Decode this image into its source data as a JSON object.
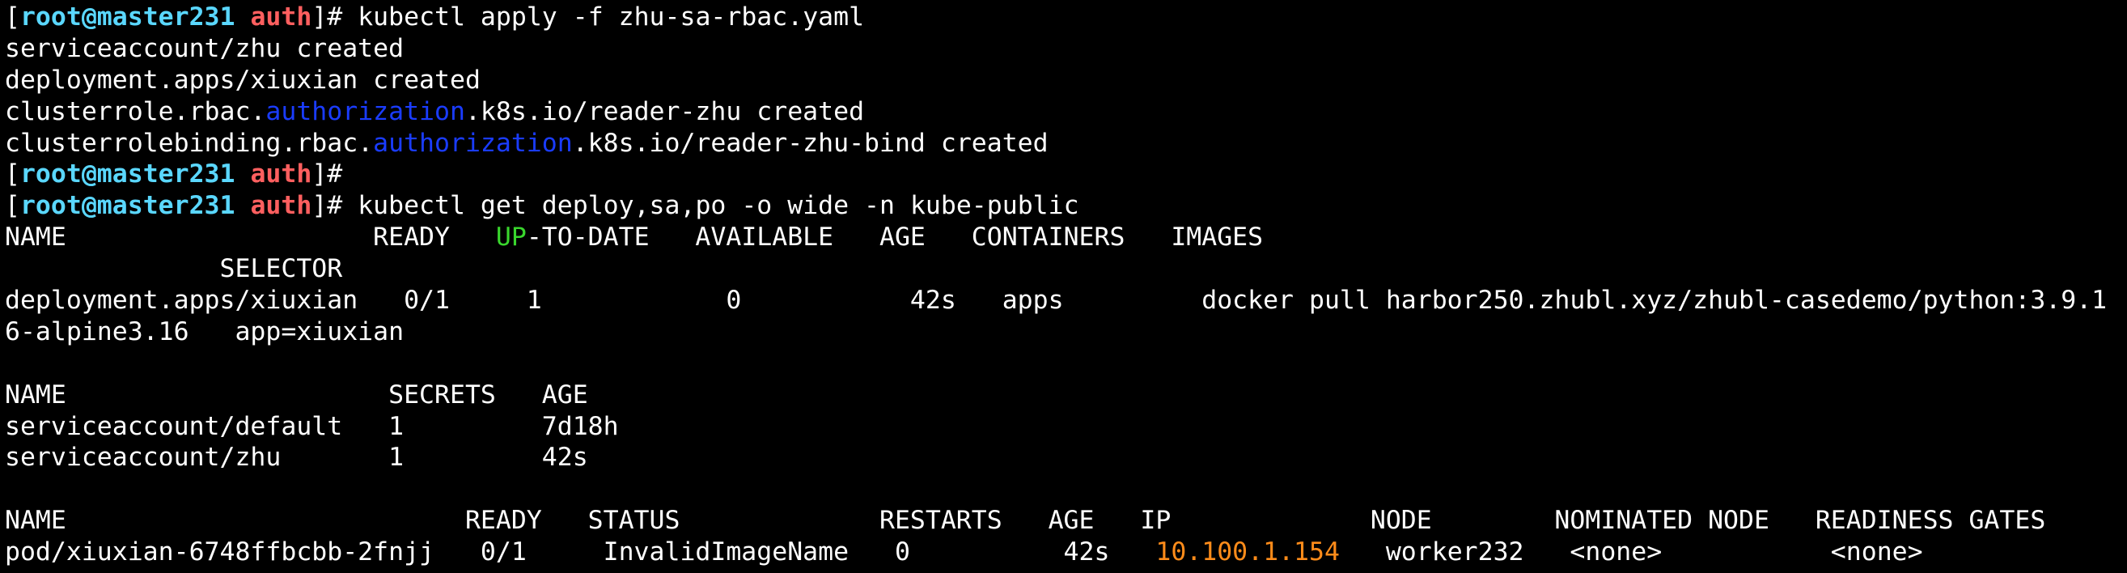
{
  "prompt": {
    "user": "root",
    "host": "master231",
    "dir": "auth",
    "symbol": "#"
  },
  "colors": {
    "background": "#000000",
    "text": "#ffffff",
    "prompt_user_host": "#5ad7ff",
    "prompt_dir": "#ff5f5f",
    "highlight_green": "#39d62d",
    "highlight_blue": "#1a3cff",
    "highlight_orange": "#ff8c1a"
  },
  "commands": {
    "apply": "kubectl apply -f zhu-sa-rbac.yaml",
    "empty": "",
    "get": "kubectl get deploy,sa,po -o wide -n kube-public"
  },
  "apply_output": {
    "sa": "serviceaccount/zhu created",
    "deploy": "deployment.apps/xiuxian created",
    "cr_prefix": "clusterrole.rbac.",
    "cr_highlight": "authorization",
    "cr_suffix": ".k8s.io/reader-zhu created",
    "crb_prefix": "clusterrolebinding.rbac.",
    "crb_highlight": "authorization",
    "crb_suffix": ".k8s.io/reader-zhu-bind created"
  },
  "deploy_table": {
    "header_a": "NAME                    READY   ",
    "header_up": "UP",
    "header_b": "-TO-DATE   AVAILABLE   AGE   CONTAINERS   IMAGES",
    "header_wrap": "              SELECTOR",
    "row": "deployment.apps/xiuxian   0/1     1            0           42s   apps         docker pull harbor250.zhubl.xyz/zhubl-casedemo/python:3.9.1",
    "row_wrap": "6-alpine3.16   app=xiuxian"
  },
  "sa_table": {
    "header": "NAME                     SECRETS   AGE",
    "rows": [
      "serviceaccount/default   1         7d18h",
      "serviceaccount/zhu       1         42s"
    ]
  },
  "pod_table": {
    "header": "NAME                          READY   STATUS             RESTARTS   AGE   IP             NODE        NOMINATED NODE   READINESS GATES",
    "row_a": "pod/xiuxian-6748ffbcbb-2fnjj   0/1     InvalidImageName   0          42s   ",
    "row_ip": "10.100.1.154",
    "row_b": "   worker232   <none>           <none>"
  }
}
